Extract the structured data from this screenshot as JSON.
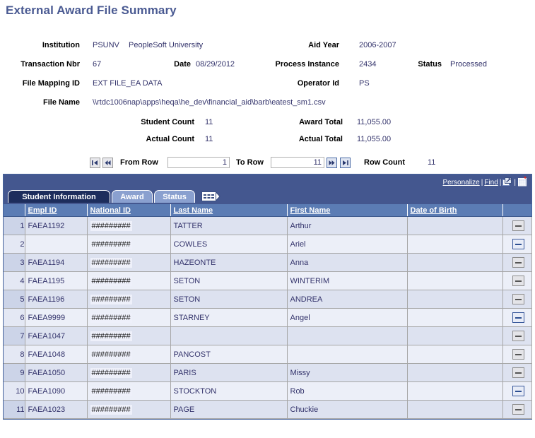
{
  "page": {
    "title": "External Award File Summary",
    "title_color": "#4a5a92"
  },
  "header": {
    "fields": [
      {
        "label": "Institution",
        "value": "PSUNV"
      },
      {
        "label": "",
        "value": "PeopleSoft University"
      },
      {
        "label": "Aid Year",
        "value": "2006-2007"
      },
      {
        "label": "Transaction Nbr",
        "value": "67"
      },
      {
        "label": "Date",
        "value": "08/29/2012"
      },
      {
        "label": "Process Instance",
        "value": "2434"
      },
      {
        "label": "Status",
        "value": "Processed"
      },
      {
        "label": "File Mapping ID",
        "value": "EXT FILE_EA DATA"
      },
      {
        "label": "Operator Id",
        "value": "PS"
      },
      {
        "label": "File Name",
        "value": "\\\\rtdc1006nap\\apps\\heqa\\he_dev\\financial_aid\\barb\\eatest_sm1.csv"
      }
    ],
    "counts": [
      {
        "label": "Student Count",
        "value": "11"
      },
      {
        "label": "Award Total",
        "value": "11,055.00"
      },
      {
        "label": "Actual Count",
        "value": "11"
      },
      {
        "label": "Actual Total",
        "value": "11,055.00"
      }
    ]
  },
  "row_nav": {
    "first_label": "first-row",
    "prev_label": "previous-rows",
    "from_row_label": "From Row",
    "from_row_value": "1",
    "to_row_label": "To Row",
    "to_row_value": "11",
    "next_label": "next-rows",
    "last_label": "last-row",
    "row_count_label": "Row Count",
    "row_count_value": "11"
  },
  "grid": {
    "links": {
      "personalize": "Personalize",
      "find": "Find",
      "separator": "|",
      "expand_icon": "expand-window-icon",
      "download_icon": "download-spreadsheet-icon"
    },
    "tabs": [
      {
        "label": "Student Information",
        "active": true
      },
      {
        "label": "Award",
        "active": false
      },
      {
        "label": "Status",
        "active": false
      }
    ],
    "tab_expand_icon": "show-all-columns-icon",
    "columns": [
      {
        "label": "",
        "key": "num"
      },
      {
        "label": "Empl ID",
        "key": "empl_id"
      },
      {
        "label": "National ID",
        "key": "national_id"
      },
      {
        "label": "Last Name",
        "key": "last_name"
      },
      {
        "label": "First Name",
        "key": "first_name"
      },
      {
        "label": "Date of Birth",
        "key": "dob"
      },
      {
        "label": "",
        "key": "action"
      }
    ],
    "rows": [
      {
        "num": "1",
        "empl_id": "FAEA1192",
        "national_id": "#########",
        "last_name": "TATTER",
        "first_name": "Arthur",
        "dob": ""
      },
      {
        "num": "2",
        "empl_id": "",
        "national_id": "#########",
        "last_name": "COWLES",
        "first_name": "Ariel",
        "dob": ""
      },
      {
        "num": "3",
        "empl_id": "FAEA1194",
        "national_id": "#########",
        "last_name": "HAZEONTE",
        "first_name": "Anna",
        "dob": ""
      },
      {
        "num": "4",
        "empl_id": "FAEA1195",
        "national_id": "#########",
        "last_name": "SETON",
        "first_name": "WINTERIM",
        "dob": ""
      },
      {
        "num": "5",
        "empl_id": "FAEA1196",
        "national_id": "#########",
        "last_name": "SETON",
        "first_name": "ANDREA",
        "dob": ""
      },
      {
        "num": "6",
        "empl_id": "FAEA9999",
        "national_id": "#########",
        "last_name": "STARNEY",
        "first_name": "Angel",
        "dob": ""
      },
      {
        "num": "7",
        "empl_id": "FAEA1047",
        "national_id": "#########",
        "last_name": "",
        "first_name": "",
        "dob": ""
      },
      {
        "num": "8",
        "empl_id": "FAEA1048",
        "national_id": "#########",
        "last_name": "PANCOST",
        "first_name": "",
        "dob": ""
      },
      {
        "num": "9",
        "empl_id": "FAEA1050",
        "national_id": "#########",
        "last_name": "PARIS",
        "first_name": "Missy",
        "dob": ""
      },
      {
        "num": "10",
        "empl_id": "FAEA1090",
        "national_id": "#########",
        "last_name": "STOCKTON",
        "first_name": "Rob",
        "dob": ""
      },
      {
        "num": "11",
        "empl_id": "FAEA1023",
        "national_id": "#########",
        "last_name": "PAGE",
        "first_name": "Chuckie",
        "dob": ""
      }
    ],
    "delete_button_label": "delete-row"
  },
  "colors": {
    "title": "#4a5a92",
    "toolbar_blue": "#44578f",
    "header_blue": "#5b7cb4",
    "tab_active": "#1d2d5c",
    "tab_inactive": "#8aa0cf",
    "row_even": "#dde2f0",
    "row_odd": "#eceff8",
    "value_text": "#33336b"
  }
}
